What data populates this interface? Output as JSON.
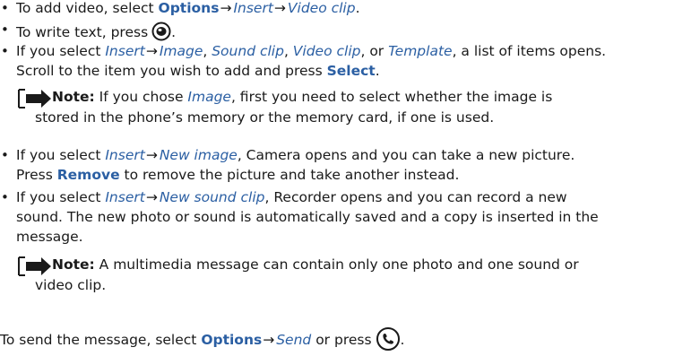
{
  "bullets": [
    {
      "lines": [
        {
          "pre": "To add video, select ",
          "b1": "Options",
          "a1": "→",
          "i1": "Insert",
          "a2": "→",
          "i2": "Video clip",
          "post": "."
        }
      ]
    },
    {
      "lines": [
        {
          "pre": "To write text, press",
          "post": "."
        }
      ]
    },
    {
      "lines": [
        {
          "pre": "If you select ",
          "i1": "Insert",
          "a1": "→",
          "i2": "Image",
          "c1": ", ",
          "i3": "Sound clip",
          "c2": ", ",
          "i4": "Video clip",
          "c3": ", or ",
          "i5": "Template",
          "post": ", a list of items opens."
        },
        {
          "pre": "Scroll to the item you wish to add and press ",
          "b1": "Select",
          "post": "."
        }
      ]
    },
    {
      "lines": [
        {
          "pre": "If you select ",
          "i1": "Insert",
          "a1": "→",
          "i2": "New image",
          "post": ", Camera opens and you can take a new picture."
        },
        {
          "pre": "Press ",
          "b1": "Remove",
          "post": " to remove the picture and take another instead."
        }
      ]
    },
    {
      "lines": [
        {
          "pre": "If you select ",
          "i1": "Insert",
          "a1": "→",
          "i2": "New sound clip",
          "post": ", Recorder opens and you can record a new"
        },
        {
          "text": "sound. The new photo or sound is automatically saved and a copy is inserted in the"
        },
        {
          "text": "message."
        }
      ]
    }
  ],
  "notes": [
    {
      "label": "Note:",
      "line1_pre": " If you chose ",
      "line1_italic": "Image",
      "line1_post": ", first you need to select whether the image is",
      "line2": "stored in the phone’s memory or the memory card, if one is used."
    },
    {
      "label": "Note:",
      "line1": " A multimedia message can contain only one photo and one sound or",
      "line2": "video clip."
    }
  ],
  "footer": {
    "pre": "To send the message, select ",
    "b1": "Options",
    "a1": "→",
    "i1": "Send",
    "post": " or press"
  },
  "icons": {
    "navi_key": "navi-key-icon",
    "call_key": "call-key-icon",
    "note": "note-arrow-icon"
  },
  "colors": {
    "accent": "#2b5fa3",
    "text": "#1a1a1a"
  }
}
